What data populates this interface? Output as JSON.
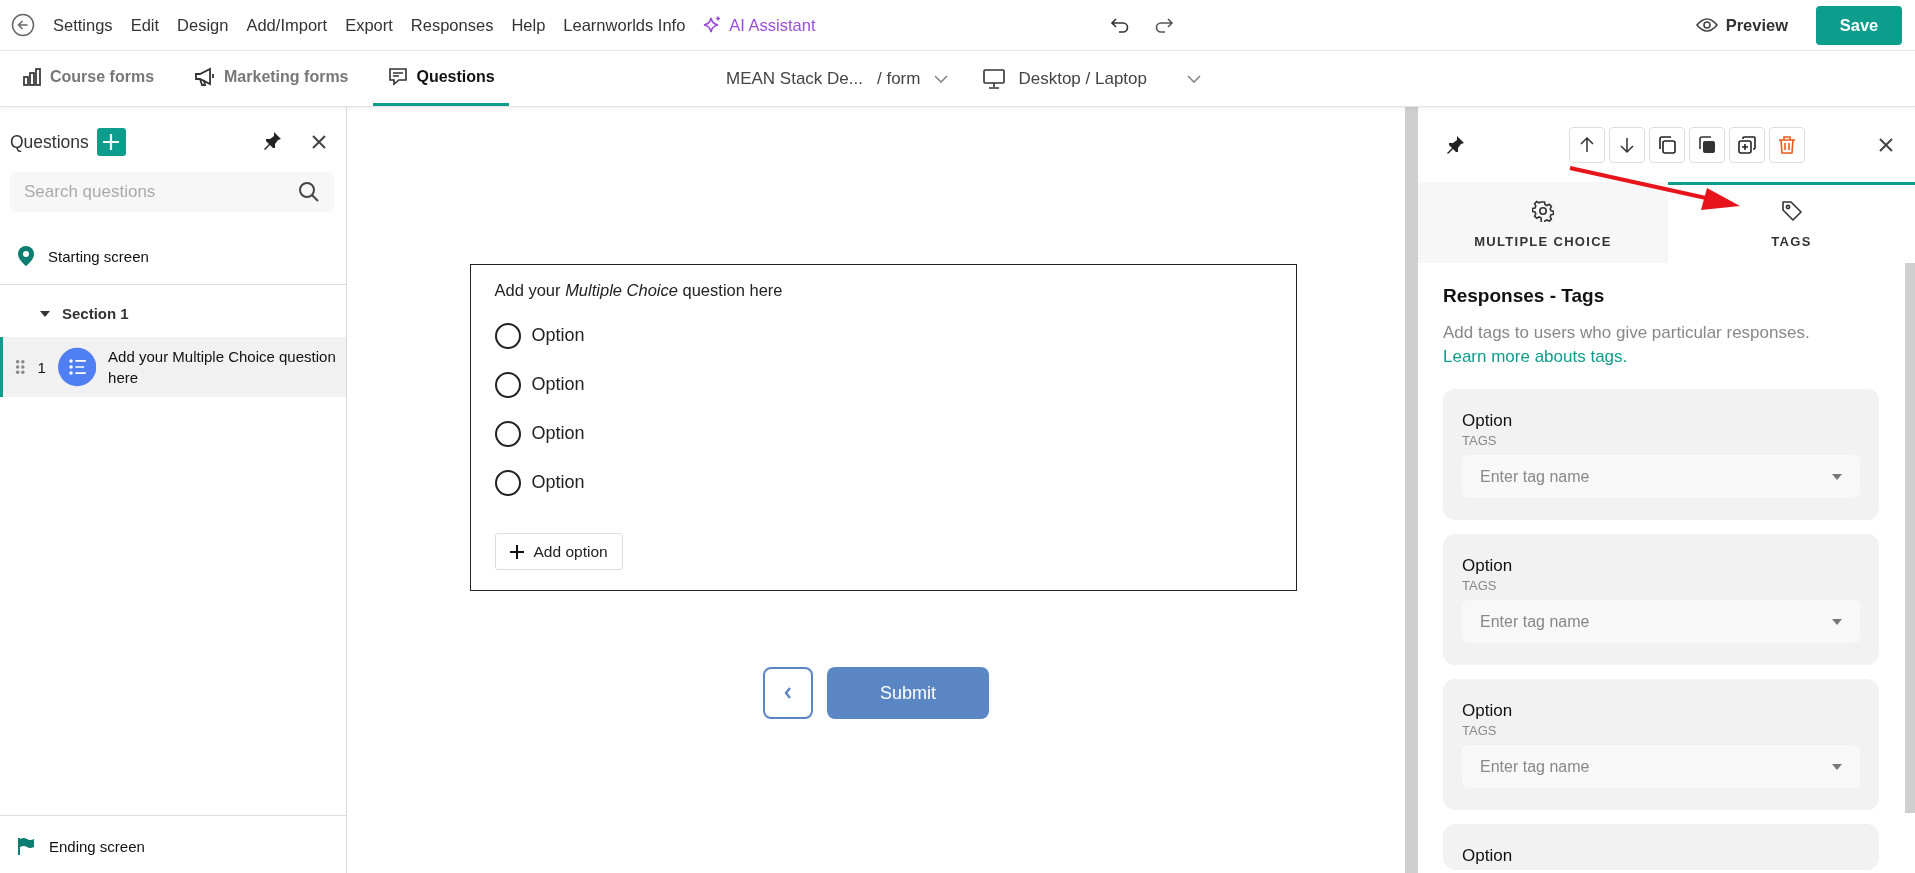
{
  "menu": {
    "items": [
      "Settings",
      "Edit",
      "Design",
      "Add/Import",
      "Export",
      "Responses",
      "Help",
      "Learnworlds Info"
    ],
    "ai_assistant": "AI Assistant",
    "preview": "Preview",
    "save": "Save"
  },
  "subbar": {
    "tabs": [
      {
        "label": "Course forms",
        "selected": false
      },
      {
        "label": "Marketing forms",
        "selected": false
      },
      {
        "label": "Questions",
        "selected": true
      }
    ],
    "course": "MEAN Stack De...",
    "form": "/ form",
    "device": "Desktop / Laptop"
  },
  "questions_panel": {
    "title": "Questions",
    "search": {
      "placeholder": "Search questions"
    },
    "starting_screen": "Starting screen",
    "sections": [
      {
        "title": "Section 1",
        "expanded": true,
        "children": [
          {
            "number": "1",
            "text": "Add your Multiple Choice question here",
            "selected": true
          }
        ]
      }
    ],
    "ending_screen": "Ending screen"
  },
  "form": {
    "question": "Add your *Multiple Choice* question here",
    "options": [
      {
        "label": "Option",
        "selected": false
      },
      {
        "label": "Option",
        "selected": false
      },
      {
        "label": "Option",
        "selected": false
      },
      {
        "label": "Option",
        "selected": false
      }
    ],
    "add_option": "Add option",
    "submit": "Submit"
  },
  "properties_panel": {
    "tabs": [
      {
        "label": "MULTIPLE CHOICE",
        "selected": false
      },
      {
        "label": "TAGS",
        "selected": true
      }
    ],
    "heading": "Responses - Tags",
    "description": "Add tags to users who give particular responses.",
    "link": "Learn more abouts tags.",
    "options": [
      {
        "label": "Option",
        "tags_label": "TAGS",
        "placeholder": "Enter tag name"
      },
      {
        "label": "Option",
        "tags_label": "TAGS",
        "placeholder": "Enter tag name"
      },
      {
        "label": "Option",
        "tags_label": "TAGS",
        "placeholder": "Enter tag name"
      },
      {
        "label": "Option"
      }
    ]
  }
}
